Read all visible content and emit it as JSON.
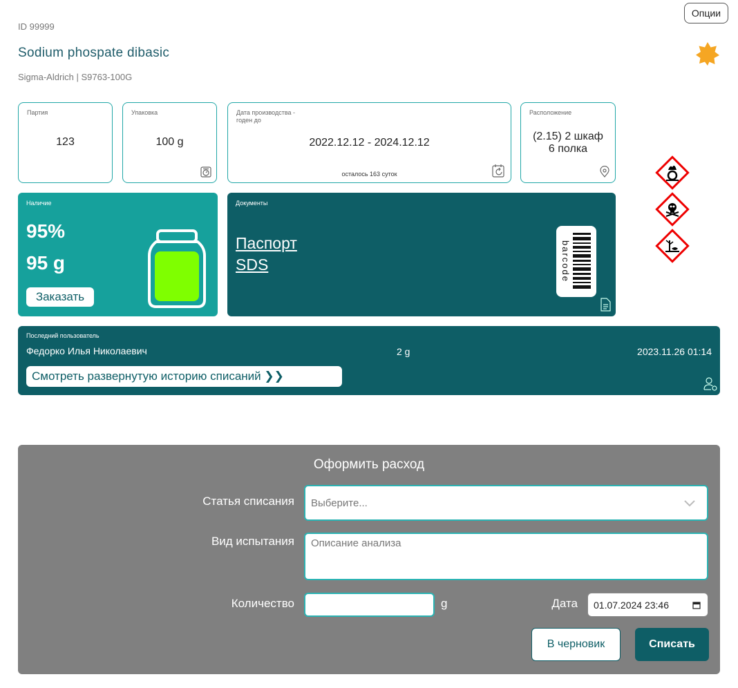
{
  "header": {
    "options_label": "Опции",
    "id_text": "ID 99999",
    "title": "Sodium phospate dibasic",
    "subtitle": "Sigma-Aldrich | S9763-100G",
    "favorite_color": "#f5a623"
  },
  "cards": {
    "batch": {
      "label": "Партия",
      "value": "123"
    },
    "package": {
      "label": "Упаковка",
      "value": "100 g",
      "icon": "scale-icon"
    },
    "dates": {
      "label": "Дата производства -\nгоден до",
      "value": "2022.12.12 - 2024.12.12",
      "remaining": "осталось 163 суток",
      "icon": "calendar-refresh-icon"
    },
    "location": {
      "label": "Расположение",
      "value_line1": "(2.15) 2 шкаф",
      "value_line2": "6 полка",
      "icon": "location-pin-icon"
    }
  },
  "hazards": [
    "oxidizer-hazard-icon",
    "toxic-skull-hazard-icon",
    "environment-hazard-icon"
  ],
  "stock": {
    "label": "Наличие",
    "percent": "95%",
    "amount": "95 g",
    "order_label": "Заказать",
    "fill_fraction": 0.95,
    "fill_color": "#7fff00"
  },
  "documents": {
    "label": "Документы",
    "passport_link": "Паспорт",
    "sds_link": "SDS",
    "barcode_text": "barcode"
  },
  "last_user": {
    "label": "Последний пользователь",
    "name": "Федорко Илья Николаевич",
    "amount": "2 g",
    "datetime": "2023.11.26 01:14",
    "history_label": "Смотреть развернутую историю списаний ❯❯"
  },
  "form": {
    "title": "Оформить расход",
    "article_label": "Статья списания",
    "article_placeholder": "Выберите...",
    "test_label": "Вид испытания",
    "test_placeholder": "Описание анализа",
    "quantity_label": "Количество",
    "quantity_value": "",
    "quantity_unit": "g",
    "date_label": "Дата",
    "date_value": "01.07.2024 23:46",
    "draft_label": "В черновик",
    "submit_label": "Списать"
  },
  "colors": {
    "teal": "#16a19c",
    "dark_teal": "#0e5e66",
    "accent_border": "#1fa6a6",
    "panel_grey": "#808080"
  }
}
